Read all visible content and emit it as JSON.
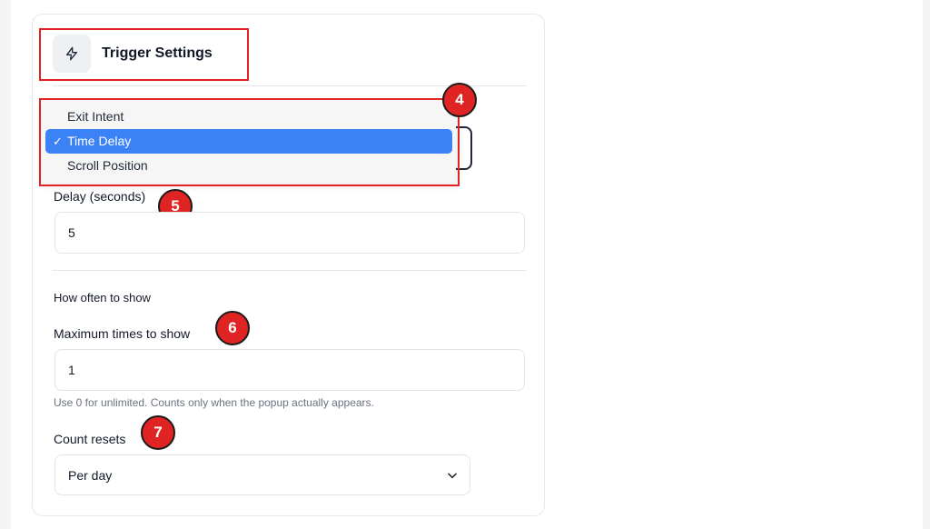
{
  "header": {
    "title": "Trigger Settings",
    "icon": "lightning-bolt-icon"
  },
  "trigger_dropdown": {
    "options": [
      {
        "label": "Exit Intent",
        "selected": false
      },
      {
        "label": "Time Delay",
        "selected": true
      },
      {
        "label": "Scroll Position",
        "selected": false
      }
    ],
    "check_mark": "✓",
    "selected_color": "#3b82f6"
  },
  "delay": {
    "label": "Delay (seconds)",
    "value": "5"
  },
  "frequency": {
    "section_label": "How often to show",
    "max_label": "Maximum times to show",
    "max_value": "1",
    "max_help": "Use 0 for unlimited. Counts only when the popup actually appears.",
    "reset_label": "Count resets",
    "reset_value": "Per day"
  },
  "annotations": {
    "color": "#e02424",
    "badges": [
      "4",
      "5",
      "6",
      "7"
    ]
  }
}
